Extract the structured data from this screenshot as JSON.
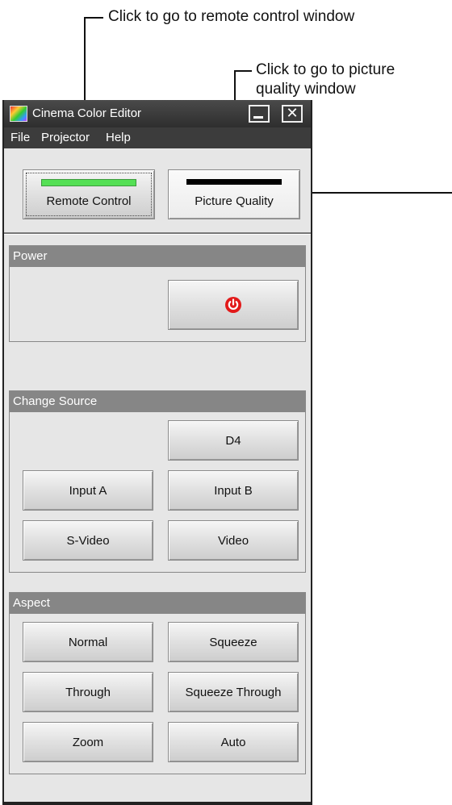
{
  "callouts": {
    "remote": "Click to go to remote control window",
    "picture_line1": "Click to go to picture",
    "picture_line2": "quality window"
  },
  "window": {
    "title": "Cinema Color Editor",
    "menu": [
      "File",
      "Projector",
      "Help"
    ],
    "minimize_icon": "minimize-icon",
    "close_glyph": "✕"
  },
  "top_buttons": {
    "remote_label": "Remote Control",
    "picture_label": "Picture Quality",
    "remote_indicator_color": "#55e055",
    "picture_indicator_color": "#000000"
  },
  "power": {
    "header": "Power",
    "icon": "power-icon",
    "icon_color": "#e21a1a"
  },
  "change_source": {
    "header": "Change Source",
    "buttons": [
      "D4",
      "Input A",
      "Input B",
      "S-Video",
      "Video"
    ]
  },
  "aspect": {
    "header": "Aspect",
    "buttons": [
      "Normal",
      "Squeeze",
      "Through",
      "Squeeze Through",
      "Zoom",
      "Auto"
    ]
  }
}
